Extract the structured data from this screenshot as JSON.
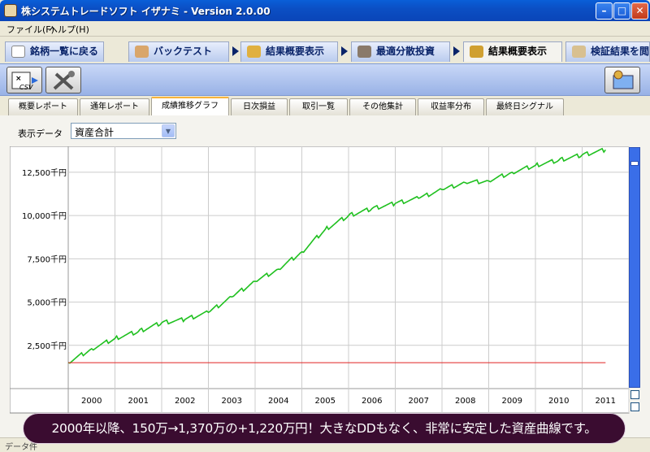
{
  "window": {
    "title": "株システムトレードソフト イザナミ - Version 2.0.00"
  },
  "menu": [
    {
      "label": "ファイル(F)"
    },
    {
      "label": "ヘルプ(H)"
    }
  ],
  "main_tabs": [
    {
      "label": "銘柄一覧に戻る"
    },
    {
      "label": "バックテスト"
    },
    {
      "label": "結果概要表示"
    },
    {
      "label": "最適分散投資"
    },
    {
      "label": "結果概要表示"
    },
    {
      "label": "検証結果を閲"
    }
  ],
  "toolbar": {
    "csv_label": "CSV"
  },
  "sub_tabs": [
    {
      "label": "概要レポート"
    },
    {
      "label": "通年レポート"
    },
    {
      "label": "成績推移グラフ"
    },
    {
      "label": "日次損益"
    },
    {
      "label": "取引一覧"
    },
    {
      "label": "その他集計"
    },
    {
      "label": "収益率分布"
    },
    {
      "label": "最終日シグナル"
    }
  ],
  "display": {
    "label": "表示データ",
    "selected": "資産合計"
  },
  "chart_data": {
    "type": "line",
    "x_categories": [
      "2000",
      "2001",
      "2002",
      "2003",
      "2004",
      "2005",
      "2006",
      "2007",
      "2008",
      "2009",
      "2010",
      "2011"
    ],
    "y_ticks": [
      {
        "value": 2500,
        "label": "2,500千円"
      },
      {
        "value": 5000,
        "label": "5,000千円"
      },
      {
        "value": 7500,
        "label": "7,500千円"
      },
      {
        "value": 10000,
        "label": "10,000千円"
      },
      {
        "value": 12500,
        "label": "12,500千円"
      }
    ],
    "ylim": [
      0,
      14000
    ],
    "grid": true,
    "series": [
      {
        "color": "#1fc01f",
        "x": [
          2000.0,
          2000.5,
          2001.0,
          2001.5,
          2002.0,
          2002.5,
          2003.0,
          2003.5,
          2004.0,
          2004.5,
          2005.0,
          2005.5,
          2006.0,
          2006.5,
          2007.0,
          2007.5,
          2008.0,
          2008.5,
          2009.0,
          2009.5,
          2010.0,
          2010.5,
          2011.0,
          2011.5
        ],
        "values": [
          1500,
          2300,
          2900,
          3300,
          3800,
          4000,
          4400,
          5300,
          6200,
          6900,
          7900,
          9200,
          10000,
          10400,
          10700,
          11000,
          11500,
          11900,
          12000,
          12500,
          12900,
          13200,
          13500,
          13800
        ]
      },
      {
        "color": "#e02020",
        "x": [
          2000.0,
          2011.5
        ],
        "values": [
          1500,
          1500
        ]
      }
    ]
  },
  "banner": {
    "text": "2000年以降、150万→1,370万の+1,220万円！大きなDDもなく、非常に安定した資産曲線です。"
  },
  "status": {
    "text": "データ件"
  }
}
